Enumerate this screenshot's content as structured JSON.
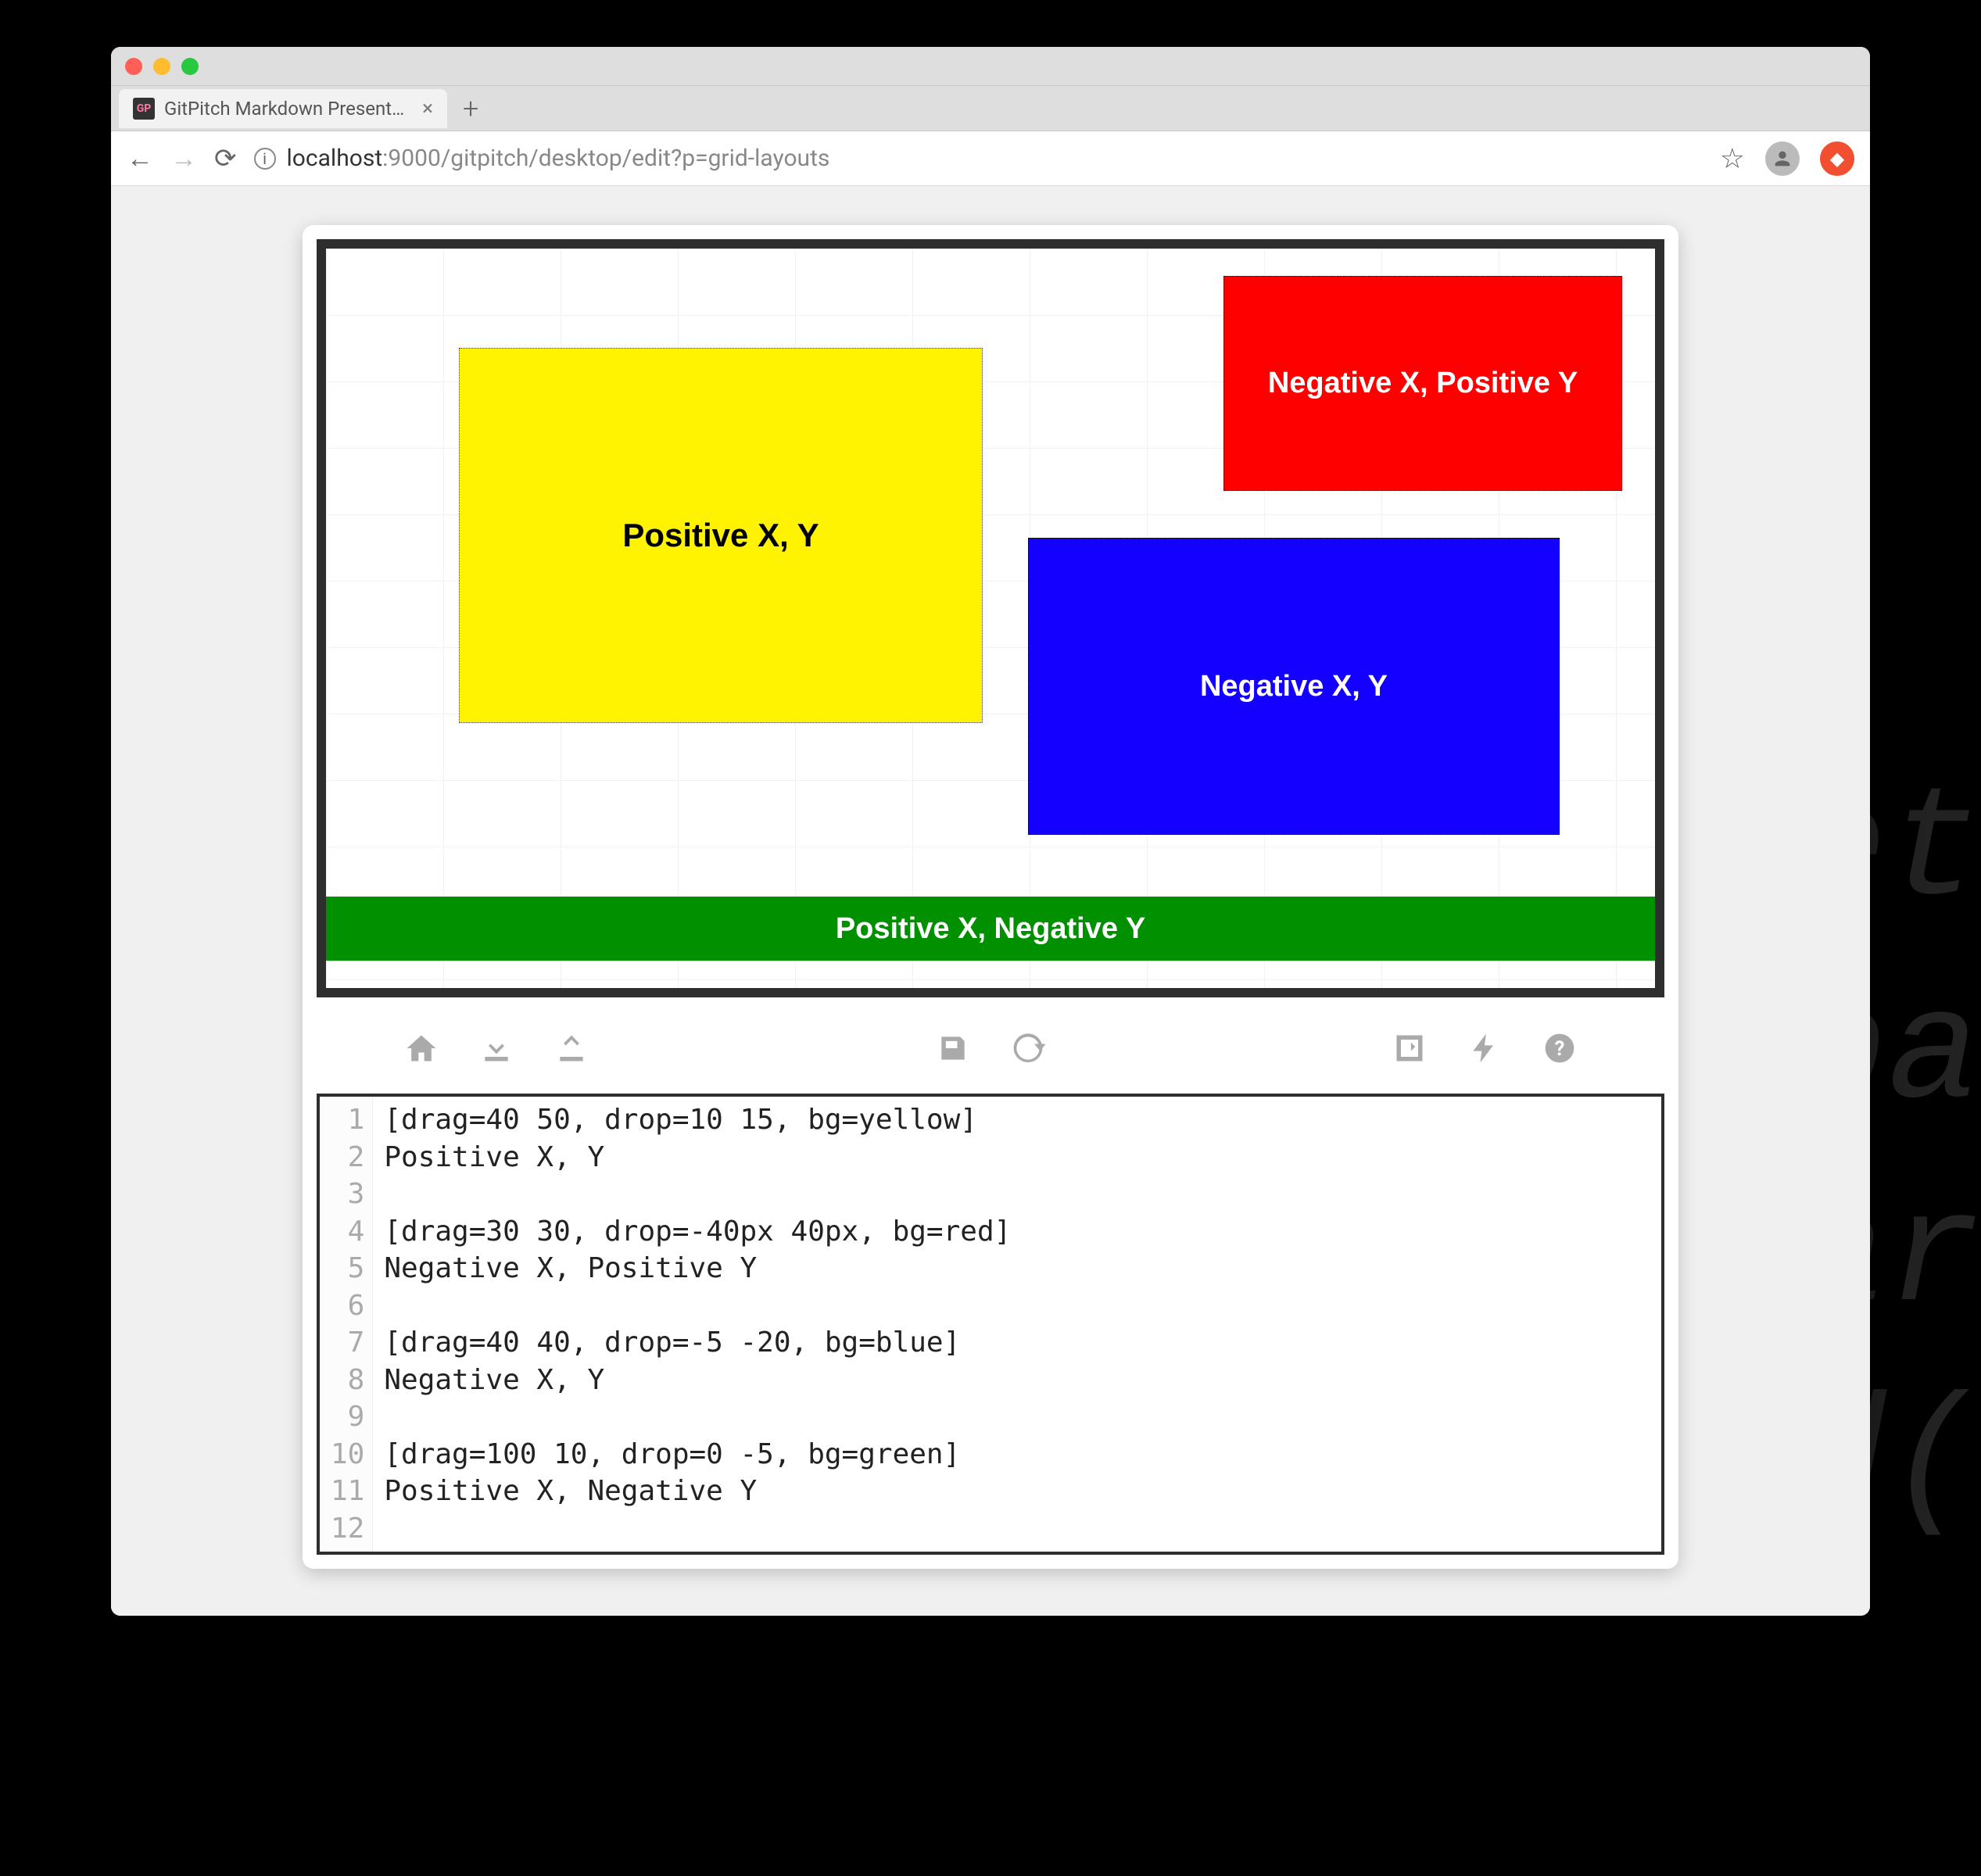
{
  "browser": {
    "tab_title": "GitPitch Markdown Presentatio",
    "favicon_text": "GP",
    "url_host_light": "localhost",
    "url_host_port": ":9000",
    "url_path": "/gitpitch/desktop/edit?p=grid-layouts"
  },
  "slide": {
    "yellow_label": "Positive X, Y",
    "red_label": "Negative X, Positive Y",
    "blue_label": "Negative X, Y",
    "green_label": "Positive X, Negative Y"
  },
  "editor_lines": [
    "[drag=40 50, drop=10 15, bg=yellow]",
    "Positive X, Y",
    "",
    "[drag=30 30, drop=-40px 40px, bg=red]",
    "Negative X, Positive Y",
    "",
    "[drag=40 40, drop=-5 -20, bg=blue]",
    "Negative X, Y",
    "",
    "[drag=100 10, drop=0 -5, bg=green]",
    "Positive X, Negative Y",
    ""
  ],
  "bg_fragments": [
    "et",
    "pa",
    "ar",
    "d("
  ]
}
